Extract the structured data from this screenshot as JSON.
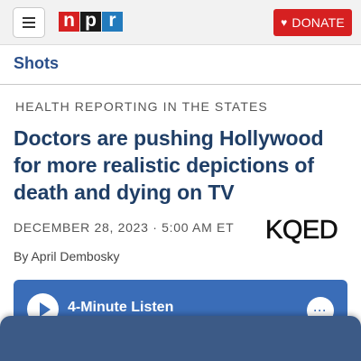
{
  "header": {
    "logo": {
      "n": "n",
      "p": "p",
      "r": "r",
      "alt": "NPR"
    },
    "donate_label": "DONATE",
    "donate_icon": "heart-icon",
    "menu_icon": "hamburger-menu-icon"
  },
  "section": {
    "title": "Shots"
  },
  "article": {
    "kicker": "HEALTH REPORTING IN THE STATES",
    "headline": "Doctors are pushing Hollywood for more realistic depictions of death and dying on TV",
    "dateline": "DECEMBER 28, 2023 · 5:00 AM ET",
    "partner_logo": "KQED",
    "byline_prefix": "By",
    "author": "April Dembosky"
  },
  "player": {
    "listen_label": "4-Minute Listen",
    "play_icon": "play-icon",
    "more_icon": "more-options-icon",
    "more_label": "···"
  },
  "colors": {
    "brand_red": "#d62021",
    "headline_blue": "#1f3e66",
    "section_blue": "#2a4f8a",
    "player_blue": "#3a6db8",
    "overlay_blue": "#3c5a86"
  }
}
